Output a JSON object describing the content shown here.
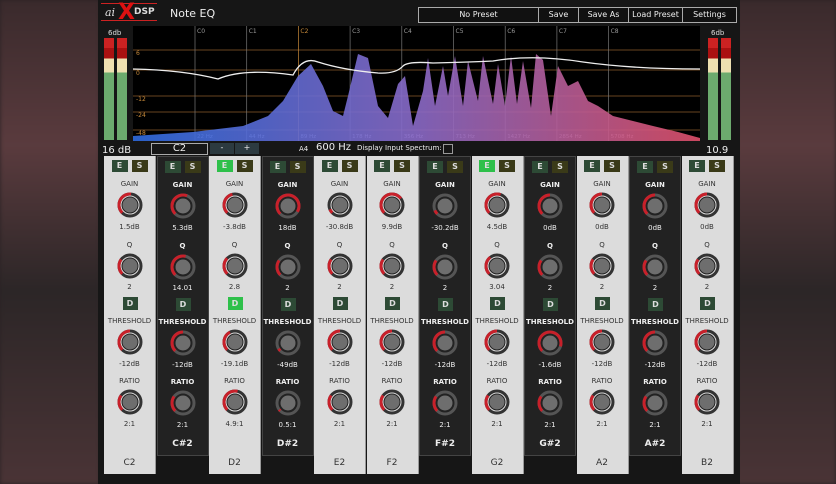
{
  "header": {
    "logo": "aiXDSP",
    "title": "Note EQ",
    "preset": "No Preset",
    "save": "Save",
    "save_as": "Save As",
    "load_preset": "Load Preset",
    "settings": "Settings"
  },
  "meters": {
    "left_top": "6db",
    "right_top": "6db",
    "left_value": "16 dB",
    "right_value": "10.9 dB"
  },
  "spectrum": {
    "notes": [
      "C0",
      "C1",
      "C2",
      "C3",
      "C4",
      "C5",
      "C6",
      "C7",
      "C8"
    ],
    "hz": [
      "22 Hz",
      "44 Hz",
      "89 Hz",
      "178 Hz",
      "356 Hz",
      "713 Hz",
      "1427 Hz",
      "2854 Hz",
      "5708 Hz"
    ],
    "db": [
      "6",
      "0",
      "-12",
      "-24",
      "-48"
    ],
    "highlight_note": "C2"
  },
  "controls": {
    "note": "C2",
    "minus": "-",
    "plus": "+",
    "ref_label": "A4",
    "ref_freq": "600 Hz",
    "display_spectrum_label": "Display Input Spectrum:",
    "display_spectrum_checked": false
  },
  "band_labels": {
    "e": "E",
    "s": "S",
    "gain": "GAIN",
    "q": "Q",
    "d": "D",
    "threshold": "THRESHOLD",
    "ratio": "RATIO"
  },
  "bands": [
    {
      "note": "C2",
      "black": false,
      "e_on": false,
      "d_on": false,
      "gain": "1.5dB",
      "q": "2",
      "threshold": "-12dB",
      "ratio": "2:1",
      "k": [
        0.52,
        0.3,
        0.5,
        0.3
      ]
    },
    {
      "note": "C#2",
      "black": true,
      "e_on": false,
      "d_on": false,
      "gain": "5.3dB",
      "q": "14.01",
      "threshold": "-12dB",
      "ratio": "2:1",
      "k": [
        0.58,
        0.55,
        0.5,
        0.3
      ]
    },
    {
      "note": "D2",
      "black": false,
      "e_on": true,
      "d_on": true,
      "gain": "-3.8dB",
      "q": "2.8",
      "threshold": "-19.1dB",
      "ratio": "4.9:1",
      "k": [
        0.45,
        0.33,
        0.4,
        0.55
      ]
    },
    {
      "note": "D#2",
      "black": true,
      "e_on": false,
      "d_on": false,
      "gain": "18dB",
      "q": "2",
      "threshold": "-49dB",
      "ratio": "0.5:1",
      "k": [
        0.95,
        0.3,
        0.05,
        0.03
      ]
    },
    {
      "note": "E2",
      "black": false,
      "e_on": false,
      "d_on": false,
      "gain": "-30.8dB",
      "q": "2",
      "threshold": "-12dB",
      "ratio": "2:1",
      "k": [
        0.08,
        0.3,
        0.5,
        0.3
      ]
    },
    {
      "note": "F2",
      "black": false,
      "e_on": false,
      "d_on": false,
      "gain": "9.9dB",
      "q": "2",
      "threshold": "-12dB",
      "ratio": "2:1",
      "k": [
        0.7,
        0.3,
        0.5,
        0.3
      ]
    },
    {
      "note": "F#2",
      "black": true,
      "e_on": false,
      "d_on": false,
      "gain": "-30.2dB",
      "q": "2",
      "threshold": "-12dB",
      "ratio": "2:1",
      "k": [
        0.08,
        0.3,
        0.5,
        0.3
      ]
    },
    {
      "note": "G2",
      "black": false,
      "e_on": true,
      "d_on": false,
      "gain": "4.5dB",
      "q": "3.04",
      "threshold": "-12dB",
      "ratio": "2:1",
      "k": [
        0.57,
        0.36,
        0.5,
        0.3
      ]
    },
    {
      "note": "G#2",
      "black": true,
      "e_on": false,
      "d_on": false,
      "gain": "0dB",
      "q": "2",
      "threshold": "-1.6dB",
      "ratio": "2:1",
      "k": [
        0.5,
        0.3,
        0.9,
        0.3
      ]
    },
    {
      "note": "A2",
      "black": false,
      "e_on": false,
      "d_on": false,
      "gain": "0dB",
      "q": "2",
      "threshold": "-12dB",
      "ratio": "2:1",
      "k": [
        0.5,
        0.3,
        0.5,
        0.3
      ]
    },
    {
      "note": "A#2",
      "black": true,
      "e_on": false,
      "d_on": false,
      "gain": "0dB",
      "q": "2",
      "threshold": "-12dB",
      "ratio": "2:1",
      "k": [
        0.5,
        0.3,
        0.5,
        0.3
      ]
    },
    {
      "note": "B2",
      "black": false,
      "e_on": false,
      "d_on": false,
      "gain": "0dB",
      "q": "2",
      "threshold": "-12dB",
      "ratio": "2:1",
      "k": [
        0.5,
        0.3,
        0.5,
        0.3
      ]
    }
  ],
  "colors": {
    "accent": "#c8202a",
    "enabled": "#2ec04a",
    "button_off": "#2d4a35"
  }
}
